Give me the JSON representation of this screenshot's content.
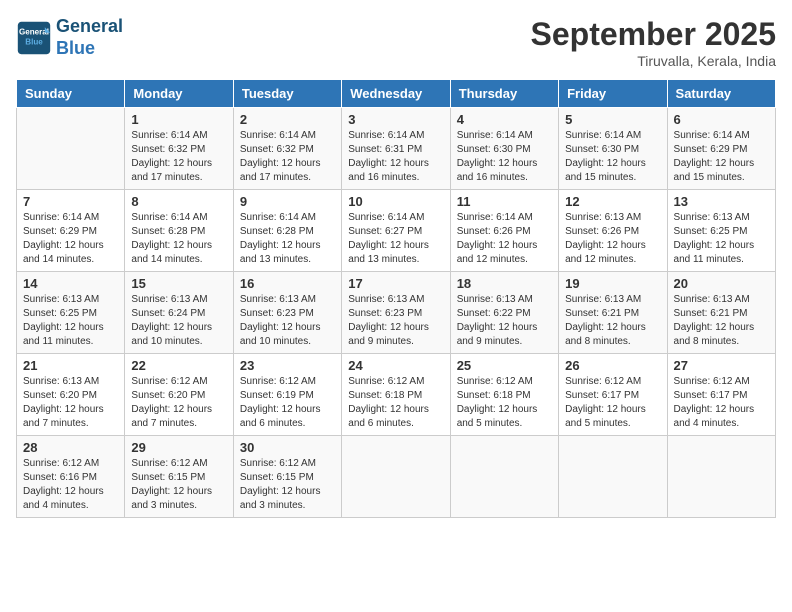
{
  "header": {
    "logo_line1": "General",
    "logo_line2": "Blue",
    "month_title": "September 2025",
    "location": "Tiruvalla, Kerala, India"
  },
  "days_of_week": [
    "Sunday",
    "Monday",
    "Tuesday",
    "Wednesday",
    "Thursday",
    "Friday",
    "Saturday"
  ],
  "weeks": [
    [
      {
        "day": "",
        "info": ""
      },
      {
        "day": "1",
        "info": "Sunrise: 6:14 AM\nSunset: 6:32 PM\nDaylight: 12 hours\nand 17 minutes."
      },
      {
        "day": "2",
        "info": "Sunrise: 6:14 AM\nSunset: 6:32 PM\nDaylight: 12 hours\nand 17 minutes."
      },
      {
        "day": "3",
        "info": "Sunrise: 6:14 AM\nSunset: 6:31 PM\nDaylight: 12 hours\nand 16 minutes."
      },
      {
        "day": "4",
        "info": "Sunrise: 6:14 AM\nSunset: 6:30 PM\nDaylight: 12 hours\nand 16 minutes."
      },
      {
        "day": "5",
        "info": "Sunrise: 6:14 AM\nSunset: 6:30 PM\nDaylight: 12 hours\nand 15 minutes."
      },
      {
        "day": "6",
        "info": "Sunrise: 6:14 AM\nSunset: 6:29 PM\nDaylight: 12 hours\nand 15 minutes."
      }
    ],
    [
      {
        "day": "7",
        "info": "Sunrise: 6:14 AM\nSunset: 6:29 PM\nDaylight: 12 hours\nand 14 minutes."
      },
      {
        "day": "8",
        "info": "Sunrise: 6:14 AM\nSunset: 6:28 PM\nDaylight: 12 hours\nand 14 minutes."
      },
      {
        "day": "9",
        "info": "Sunrise: 6:14 AM\nSunset: 6:28 PM\nDaylight: 12 hours\nand 13 minutes."
      },
      {
        "day": "10",
        "info": "Sunrise: 6:14 AM\nSunset: 6:27 PM\nDaylight: 12 hours\nand 13 minutes."
      },
      {
        "day": "11",
        "info": "Sunrise: 6:14 AM\nSunset: 6:26 PM\nDaylight: 12 hours\nand 12 minutes."
      },
      {
        "day": "12",
        "info": "Sunrise: 6:13 AM\nSunset: 6:26 PM\nDaylight: 12 hours\nand 12 minutes."
      },
      {
        "day": "13",
        "info": "Sunrise: 6:13 AM\nSunset: 6:25 PM\nDaylight: 12 hours\nand 11 minutes."
      }
    ],
    [
      {
        "day": "14",
        "info": "Sunrise: 6:13 AM\nSunset: 6:25 PM\nDaylight: 12 hours\nand 11 minutes."
      },
      {
        "day": "15",
        "info": "Sunrise: 6:13 AM\nSunset: 6:24 PM\nDaylight: 12 hours\nand 10 minutes."
      },
      {
        "day": "16",
        "info": "Sunrise: 6:13 AM\nSunset: 6:23 PM\nDaylight: 12 hours\nand 10 minutes."
      },
      {
        "day": "17",
        "info": "Sunrise: 6:13 AM\nSunset: 6:23 PM\nDaylight: 12 hours\nand 9 minutes."
      },
      {
        "day": "18",
        "info": "Sunrise: 6:13 AM\nSunset: 6:22 PM\nDaylight: 12 hours\nand 9 minutes."
      },
      {
        "day": "19",
        "info": "Sunrise: 6:13 AM\nSunset: 6:21 PM\nDaylight: 12 hours\nand 8 minutes."
      },
      {
        "day": "20",
        "info": "Sunrise: 6:13 AM\nSunset: 6:21 PM\nDaylight: 12 hours\nand 8 minutes."
      }
    ],
    [
      {
        "day": "21",
        "info": "Sunrise: 6:13 AM\nSunset: 6:20 PM\nDaylight: 12 hours\nand 7 minutes."
      },
      {
        "day": "22",
        "info": "Sunrise: 6:12 AM\nSunset: 6:20 PM\nDaylight: 12 hours\nand 7 minutes."
      },
      {
        "day": "23",
        "info": "Sunrise: 6:12 AM\nSunset: 6:19 PM\nDaylight: 12 hours\nand 6 minutes."
      },
      {
        "day": "24",
        "info": "Sunrise: 6:12 AM\nSunset: 6:18 PM\nDaylight: 12 hours\nand 6 minutes."
      },
      {
        "day": "25",
        "info": "Sunrise: 6:12 AM\nSunset: 6:18 PM\nDaylight: 12 hours\nand 5 minutes."
      },
      {
        "day": "26",
        "info": "Sunrise: 6:12 AM\nSunset: 6:17 PM\nDaylight: 12 hours\nand 5 minutes."
      },
      {
        "day": "27",
        "info": "Sunrise: 6:12 AM\nSunset: 6:17 PM\nDaylight: 12 hours\nand 4 minutes."
      }
    ],
    [
      {
        "day": "28",
        "info": "Sunrise: 6:12 AM\nSunset: 6:16 PM\nDaylight: 12 hours\nand 4 minutes."
      },
      {
        "day": "29",
        "info": "Sunrise: 6:12 AM\nSunset: 6:15 PM\nDaylight: 12 hours\nand 3 minutes."
      },
      {
        "day": "30",
        "info": "Sunrise: 6:12 AM\nSunset: 6:15 PM\nDaylight: 12 hours\nand 3 minutes."
      },
      {
        "day": "",
        "info": ""
      },
      {
        "day": "",
        "info": ""
      },
      {
        "day": "",
        "info": ""
      },
      {
        "day": "",
        "info": ""
      }
    ]
  ]
}
